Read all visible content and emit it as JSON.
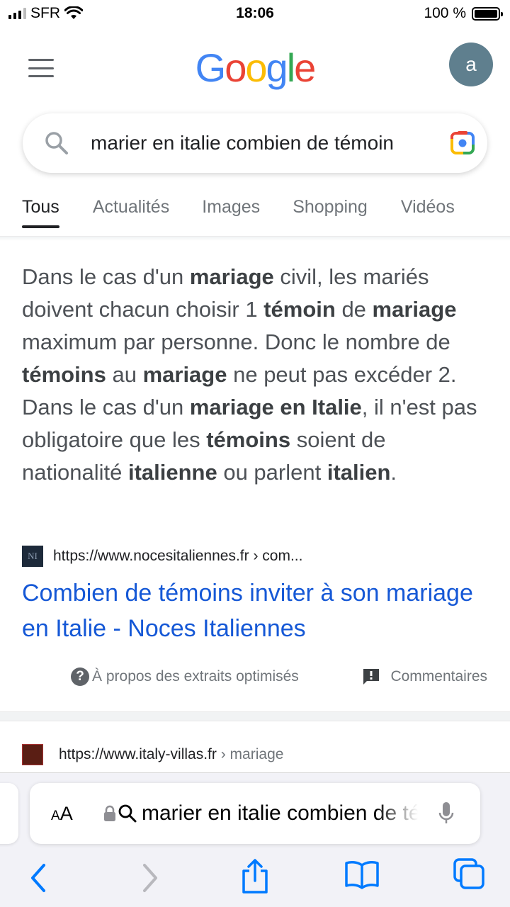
{
  "status_bar": {
    "carrier": "SFR",
    "time": "18:06",
    "battery": "100 %"
  },
  "header": {
    "logo_letters": [
      {
        "char": "G",
        "color": "#4285F4"
      },
      {
        "char": "o",
        "color": "#EA4335"
      },
      {
        "char": "o",
        "color": "#FBBC05"
      },
      {
        "char": "g",
        "color": "#4285F4"
      },
      {
        "char": "l",
        "color": "#34A853"
      },
      {
        "char": "e",
        "color": "#EA4335"
      }
    ],
    "avatar_letter": "a"
  },
  "search": {
    "query": "marier en italie combien de témoin"
  },
  "tabs": [
    {
      "label": "Tous",
      "active": true
    },
    {
      "label": "Actualités",
      "active": false
    },
    {
      "label": "Images",
      "active": false
    },
    {
      "label": "Shopping",
      "active": false
    },
    {
      "label": "Vidéos",
      "active": false
    }
  ],
  "snippet": {
    "segments": [
      {
        "t": "Dans le cas d'un ",
        "b": false
      },
      {
        "t": "mariage",
        "b": true
      },
      {
        "t": " civil, les mariés doivent chacun choisir 1 ",
        "b": false
      },
      {
        "t": "témoin",
        "b": true
      },
      {
        "t": " de ",
        "b": false
      },
      {
        "t": "mariage",
        "b": true
      },
      {
        "t": " maximum par personne. Donc le nombre de ",
        "b": false
      },
      {
        "t": "témoins",
        "b": true
      },
      {
        "t": " au ",
        "b": false
      },
      {
        "t": "mariage",
        "b": true
      },
      {
        "t": " ne peut pas excéder 2. Dans le cas d'un ",
        "b": false
      },
      {
        "t": "mariage en Italie",
        "b": true
      },
      {
        "t": ", il n'est pas obligatoire que les ",
        "b": false
      },
      {
        "t": "témoins",
        "b": true
      },
      {
        "t": " soient de nationalité ",
        "b": false
      },
      {
        "t": "italienne",
        "b": true
      },
      {
        "t": " ou parlent ",
        "b": false
      },
      {
        "t": "italien",
        "b": true
      },
      {
        "t": ".",
        "b": false
      }
    ]
  },
  "result1": {
    "favicon_text": "NI",
    "url": "https://www.nocesitaliennes.fr › com...",
    "title": "Combien de témoins inviter à son mariage en Italie - Noces Italiennes"
  },
  "snippet_meta": {
    "about_label": "À propos des extraits optimisés",
    "feedback_label": "Commentaires"
  },
  "result2": {
    "url": "https://www.italy-villas.fr",
    "breadcrumb": " › mariage"
  },
  "safari": {
    "aa_label": "AA",
    "address_text": "marier en italie combien de témoin"
  },
  "colors": {
    "link": "#1558d6",
    "accent_ios": "#007aff"
  }
}
